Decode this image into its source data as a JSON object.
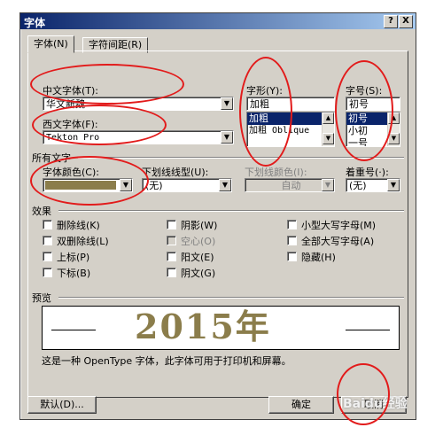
{
  "window": {
    "title": "字体",
    "help_button": "?",
    "close_button": "X"
  },
  "tabs": [
    {
      "label": "字体(N)"
    },
    {
      "label": "字符间距(R)"
    }
  ],
  "fonts": {
    "chinese_font_label": "中文字体(T):",
    "chinese_font_value": "华文新魏",
    "western_font_label": "西文字体(F):",
    "western_font_value": "Tekton Pro",
    "style_label": "字形(Y):",
    "style_value": "加粗",
    "style_options": [
      "加粗",
      "加粗 Oblique"
    ],
    "size_label": "字号(S):",
    "size_value": "初号",
    "size_options": [
      "初号",
      "小初",
      "一号"
    ]
  },
  "all_text": {
    "section_label": "所有文字",
    "font_color_label": "字体颜色(C):",
    "font_color_swatch": "#8b7d4b",
    "underline_style_label": "下划线线型(U):",
    "underline_style_value": "(无)",
    "underline_color_label": "下划线颜色(I):",
    "underline_color_value": "自动",
    "emphasis_label": "着重号(·):",
    "emphasis_value": "(无)"
  },
  "effects": {
    "section_label": "效果",
    "col1": [
      "删除线(K)",
      "双删除线(L)",
      "上标(P)",
      "下标(B)"
    ],
    "col2": [
      "阴影(W)",
      "空心(O)",
      "阳文(E)",
      "阴文(G)"
    ],
    "col3": [
      "小型大写字母(M)",
      "全部大写字母(A)",
      "隐藏(H)"
    ]
  },
  "preview": {
    "section_label": "预览",
    "sample_text": "2015年",
    "sample_color": "#8b7d4b",
    "description": "这是一种 OpenType 字体，此字体可用于打印机和屏幕。"
  },
  "buttons": {
    "default": "默认(D)...",
    "ok": "确定",
    "cancel": "取消"
  },
  "watermark": "Baidu经验",
  "annotation_color": "#e21b1b"
}
